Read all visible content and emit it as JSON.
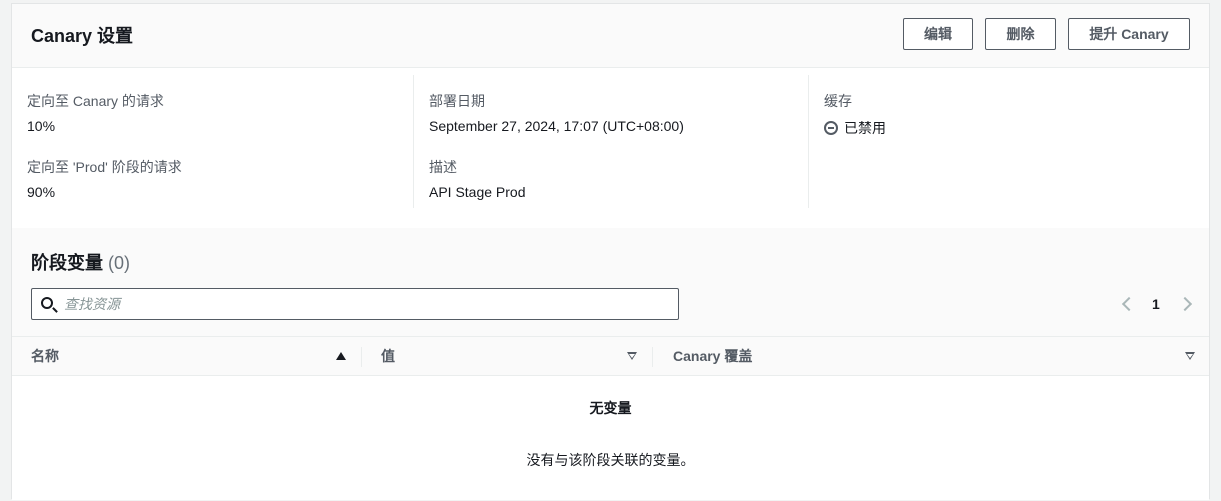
{
  "header": {
    "title": "Canary 设置",
    "edit_label": "编辑",
    "delete_label": "删除",
    "promote_label": "提升 Canary"
  },
  "details": {
    "canary_requests_label": "定向至 Canary 的请求",
    "canary_requests_value": "10%",
    "prod_requests_label": "定向至 'Prod' 阶段的请求",
    "prod_requests_value": "90%",
    "deploy_date_label": "部署日期",
    "deploy_date_value": "September 27, 2024, 17:07 (UTC+08:00)",
    "description_label": "描述",
    "description_value": "API Stage Prod",
    "cache_label": "缓存",
    "cache_value": "已禁用"
  },
  "stage_variables": {
    "title": "阶段变量",
    "count": "(0)",
    "search_placeholder": "查找资源",
    "page": "1",
    "columns": [
      "名称",
      "值",
      "Canary 覆盖"
    ],
    "empty_title": "无变量",
    "empty_desc": "没有与该阶段关联的变量。"
  }
}
